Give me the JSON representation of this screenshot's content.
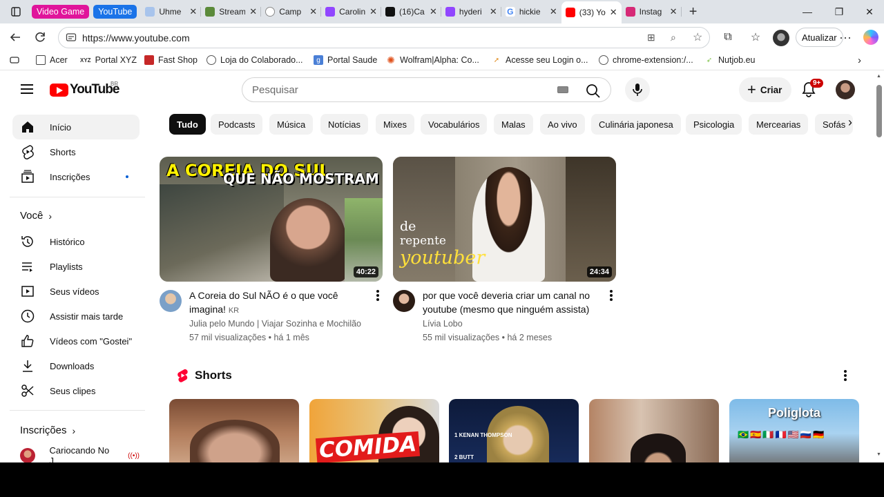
{
  "browser": {
    "tab_groups": [
      {
        "label": "Video Game",
        "color": "#e0159b"
      },
      {
        "label": "YouTube",
        "color": "#1a73e8"
      }
    ],
    "tabs": [
      {
        "title": "Uhme",
        "fav_color": "#a8c4ec"
      },
      {
        "title": "Stream",
        "fav_color": "#5b8a3a"
      },
      {
        "title": "Camp",
        "fav_color": "#8a8a8a"
      },
      {
        "title": "Carolin",
        "fav_color": "#9146ff"
      },
      {
        "title": "(16)Ca",
        "fav_color": "#111111"
      },
      {
        "title": "hyderi",
        "fav_color": "#9146ff"
      },
      {
        "title": "hickie",
        "fav_color": "#4285f4"
      },
      {
        "title": "(33) Yo",
        "fav_color": "#ff0000"
      },
      {
        "title": "Instag",
        "fav_color": "#d62976"
      }
    ],
    "url": "https://www.youtube.com",
    "update_label": "Atualizar",
    "bookmarks": [
      "Acer",
      "Portal XYZ",
      "Fast Shop",
      "Loja do Colaborado...",
      "Portal Saude",
      "Wolfram|Alpha: Co...",
      "Acesse seu Login o...",
      "chrome-extension:/...",
      "Nutjob.eu"
    ],
    "bookmark_prefix": "XYZ"
  },
  "youtube": {
    "logo_text": "YouTube",
    "country_code": "BR",
    "search_placeholder": "Pesquisar",
    "create_label": "Criar",
    "notification_badge": "9+"
  },
  "sidebar": {
    "main": [
      {
        "label": "Início",
        "icon": "home-icon"
      },
      {
        "label": "Shorts",
        "icon": "shorts-icon"
      },
      {
        "label": "Inscrições",
        "icon": "subscriptions-icon"
      }
    ],
    "you_header": "Você",
    "you_items": [
      {
        "label": "Histórico",
        "icon": "history-icon"
      },
      {
        "label": "Playlists",
        "icon": "playlists-icon"
      },
      {
        "label": "Seus vídeos",
        "icon": "your-videos-icon"
      },
      {
        "label": "Assistir mais tarde",
        "icon": "watch-later-icon"
      },
      {
        "label": "Vídeos com \"Gostei\"",
        "icon": "liked-icon"
      },
      {
        "label": "Downloads",
        "icon": "download-icon"
      },
      {
        "label": "Seus clipes",
        "icon": "clips-icon"
      }
    ],
    "subs_header": "Inscrições",
    "subs": [
      {
        "label": "Cariocando No J..."
      }
    ]
  },
  "chips": [
    "Tudo",
    "Podcasts",
    "Música",
    "Notícias",
    "Mixes",
    "Vocabulários",
    "Malas",
    "Ao vivo",
    "Culinária japonesa",
    "Psicologia",
    "Mercearias",
    "Sofás"
  ],
  "videos": [
    {
      "title": "A Coreia do Sul NÃO é o que você imagina!",
      "title_suffix": "KR",
      "thumb_text_1": "A COREIA DO SUL",
      "thumb_text_2": "QUE NÃO MOSTRAM",
      "channel": "Julia pelo Mundo | Viajar Sozinha e Mochilão",
      "meta": "57 mil visualizações • há 1 mês",
      "duration": "40:22"
    },
    {
      "title": "por que você deveria criar um canal no youtube (mesmo que ninguém assista)",
      "thumb_text_1": "de",
      "thumb_text_2": "repente",
      "thumb_text_3": "youtuber",
      "channel": "Lívia Lobo",
      "meta": "55 mil visualizações • há 2 meses",
      "duration": "24:34"
    }
  ],
  "shorts": {
    "header": "Shorts",
    "items": [
      {
        "overlay": ""
      },
      {
        "overlay": "COMIDA"
      },
      {
        "overlay": "1 KENAN THOMPSON",
        "overlay2": "2 BUTT"
      },
      {
        "overlay": ""
      },
      {
        "overlay": "Poliglota"
      }
    ]
  }
}
